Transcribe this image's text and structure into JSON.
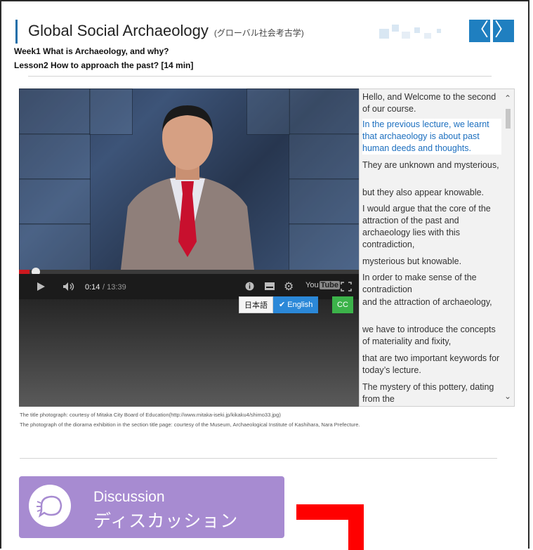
{
  "header": {
    "title": "Global Social Archaeology",
    "title_ja": "(グローバル社会考古学)",
    "prev_icon": "chevron-left-icon",
    "next_icon": "chevron-right-icon",
    "prev_label": "〈",
    "next_label": "〉",
    "accent_color": "#1f7fc0"
  },
  "lesson": {
    "week": "Week1 What is Archaeology, and why?",
    "lesson": "Lesson2 How to approach the past? [14 min]"
  },
  "player": {
    "current_time": "0:14",
    "total_time": "/ 13:39",
    "progress_fraction": 0.017,
    "lang_options": [
      "日本語",
      "English"
    ],
    "selected_lang": "✔ English",
    "cc_label": "CC",
    "youtube_label": "You",
    "youtube_label2": "Tube",
    "icons": [
      "play-icon",
      "volume-icon",
      "info-icon",
      "captions-icon",
      "gear-icon",
      "youtube-icon",
      "fullscreen-icon"
    ]
  },
  "transcript": {
    "lines": [
      "Hello, and Welcome to the second of our course.",
      "In the previous lecture, we learnt that archaeology is about past human deeds and thoughts.",
      "They are unknown and mysterious,",
      "but they also appear knowable.",
      "I would argue that the core of the attraction of the past and archaeology lies with this contradiction,",
      "mysterious but knowable.",
      "In order to make sense of the contradiction",
      "and the attraction of archaeology,",
      "we have to introduce the concepts of materiality and fixity,",
      "that are two important keywords for today’s lecture.",
      "The mystery of this pottery, dating from the"
    ],
    "active_index": 1
  },
  "credits": {
    "line1": "The title photograph: courtesy of Mitaka City Board of Education(http://www.mitaka-iseki.jp/kikaku4/shimo33.jpg)",
    "line2": "The photograph of the diorama exhibition in the section title page: courtesy of the Museum, Archaeological Institute of Kashihara, Nara Prefecture."
  },
  "discussion": {
    "label_en": "Discussion",
    "label_ja": "ディスカッション",
    "icon": "discussion-icon",
    "color": "#a78bd1"
  },
  "annotation_color": "#ff0000"
}
